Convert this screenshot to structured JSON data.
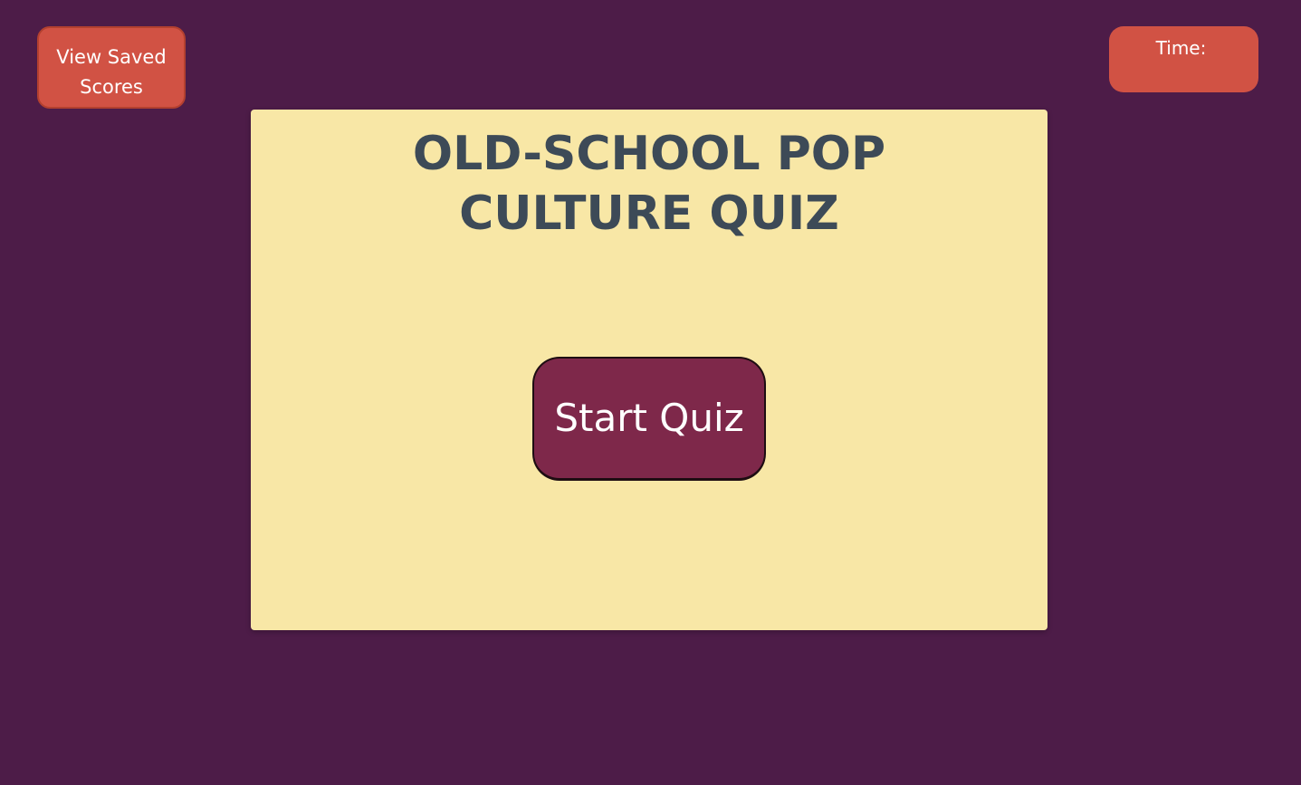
{
  "header": {
    "saved_scores_label": "View Saved Scores",
    "timer_label": "Time:",
    "timer_value": ""
  },
  "main": {
    "title": "Old-School Pop Culture Quiz",
    "start_button_label": "Start Quiz"
  },
  "colors": {
    "background": "#4d1c48",
    "card": "#f8e7a6",
    "accent_button": "#d15244",
    "start_button": "#7e284a",
    "title_text": "#3d4a57"
  }
}
